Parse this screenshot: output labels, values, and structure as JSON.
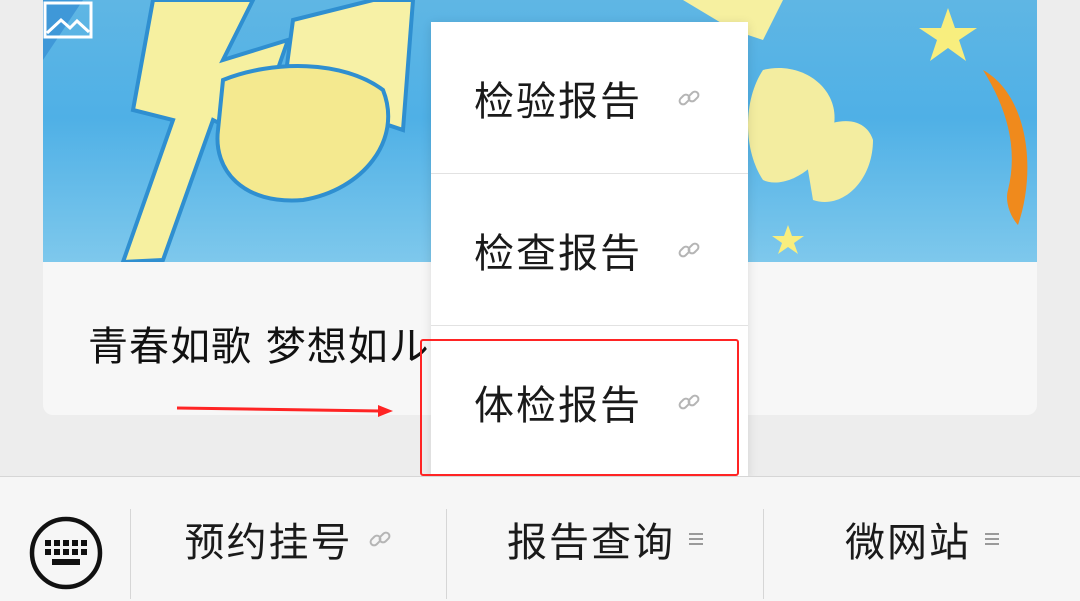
{
  "article": {
    "title": "青春如歌 梦想如ル",
    "image_icon": "image-icon"
  },
  "popup": {
    "items": [
      {
        "label": "检验报告",
        "icon": "link-icon"
      },
      {
        "label": "检查报告",
        "icon": "link-icon"
      },
      {
        "label": "体检报告",
        "icon": "link-icon"
      }
    ],
    "highlighted_index": 2
  },
  "menubar": {
    "keyboard_icon": "keyboard-icon",
    "items": [
      {
        "label": "预约挂号",
        "icon": "link-icon"
      },
      {
        "label": "报告查询",
        "icon": "menu-lines-icon"
      },
      {
        "label": "微网站",
        "icon": "menu-lines-icon"
      }
    ]
  },
  "colors": {
    "annotation_red": "#ff2424",
    "banner_blue": "#4fb0e6",
    "menubar_bg": "#f6f6f6"
  }
}
